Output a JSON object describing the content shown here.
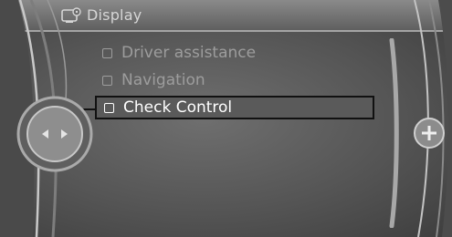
{
  "header": {
    "title": "Display",
    "icon": "display-settings-icon"
  },
  "menu": {
    "items": [
      {
        "label": "Driver assistance",
        "selected": false
      },
      {
        "label": "Navigation",
        "selected": false
      },
      {
        "label": "Check Control",
        "selected": true
      }
    ]
  },
  "controller": {
    "left_knob_icon": "left-right-arrows-icon",
    "right_knob_icon": "plus-icon"
  }
}
